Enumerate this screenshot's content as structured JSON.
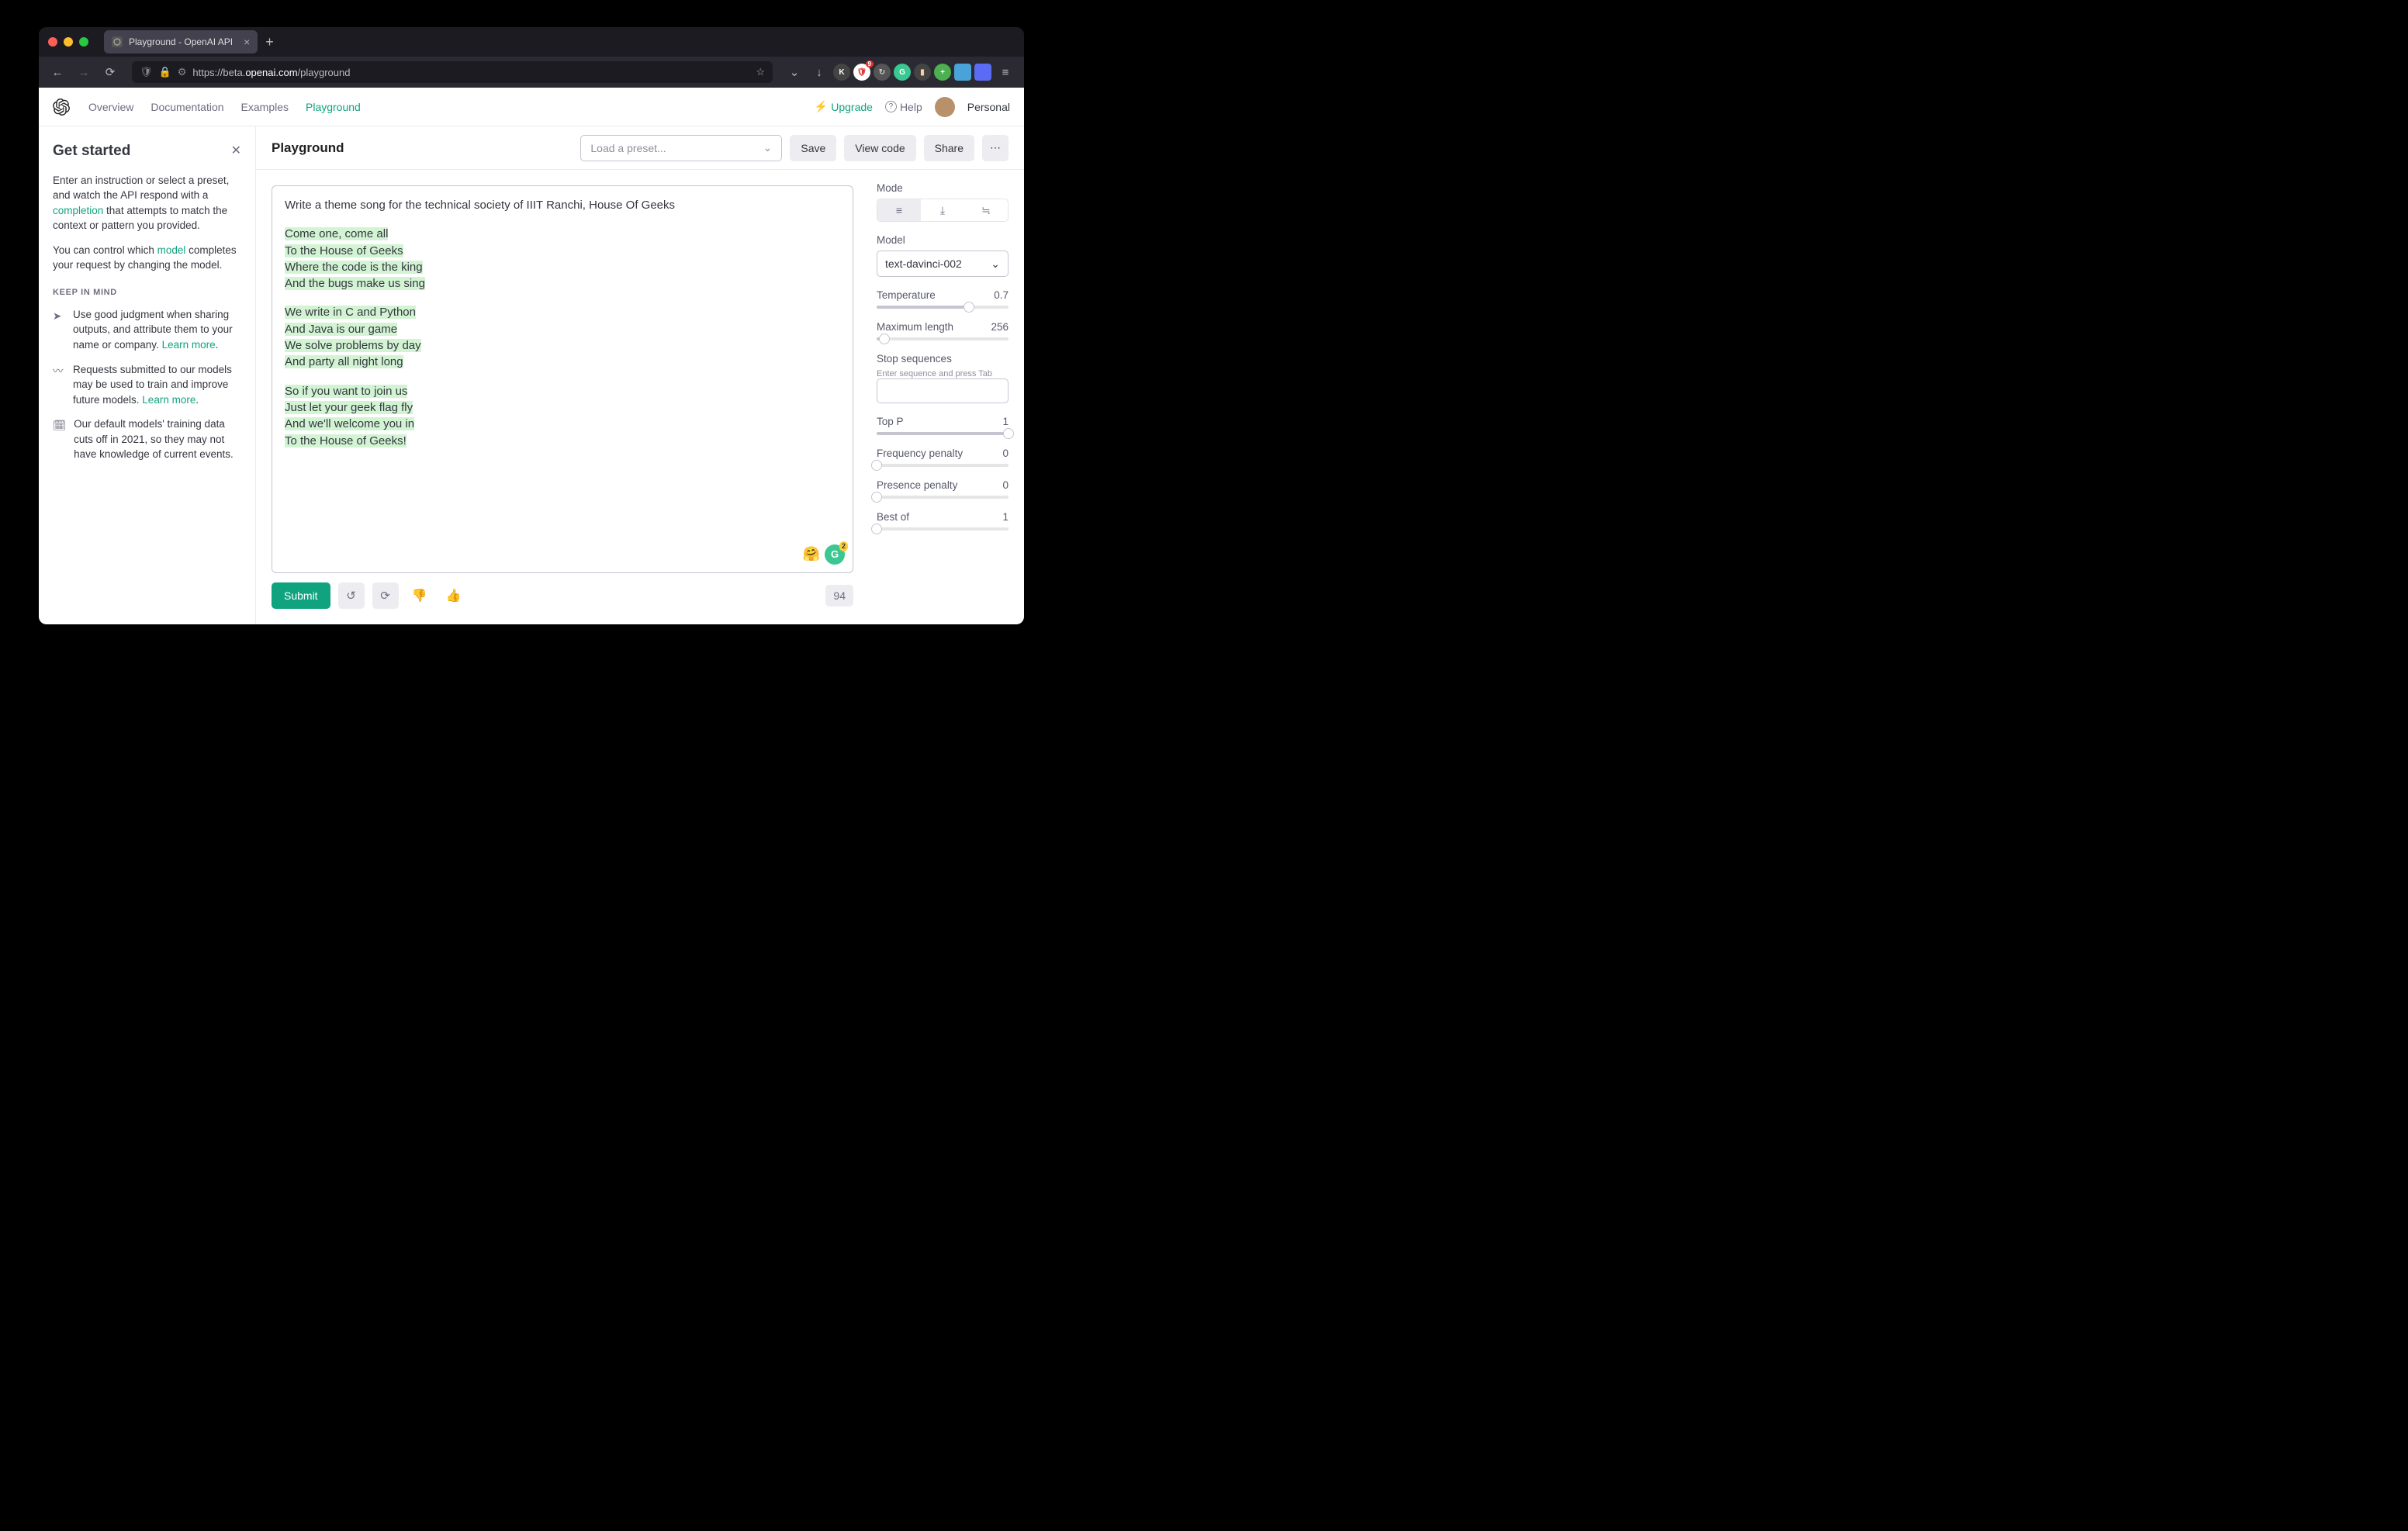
{
  "browser": {
    "tab_title": "Playground - OpenAI API",
    "url_prefix": "https://",
    "url_sub": "beta.",
    "url_domain": "openai.com",
    "url_path": "/playground",
    "ext_badge": "9"
  },
  "nav": {
    "overview": "Overview",
    "documentation": "Documentation",
    "examples": "Examples",
    "playground": "Playground",
    "upgrade": "Upgrade",
    "help": "Help",
    "personal": "Personal"
  },
  "sidebar": {
    "title": "Get started",
    "p1a": "Enter an instruction or select a preset, and watch the API respond with a ",
    "p1_link": "completion",
    "p1b": " that attempts to match the context or pattern you provided.",
    "p2a": "You can control which ",
    "p2_link": "model",
    "p2b": " completes your request by changing the model.",
    "kim_heading": "KEEP IN MIND",
    "kim1": "Use good judgment when sharing outputs, and attribute them to your name or company. ",
    "kim1_link": "Learn more",
    "kim2": "Requests submitted to our models may be used to train and improve future models. ",
    "kim2_link": "Learn more",
    "kim3": "Our default models' training data cuts off in 2021, so they may not have knowledge of current events."
  },
  "playground": {
    "title": "Playground",
    "preset_placeholder": "Load a preset...",
    "save": "Save",
    "view_code": "View code",
    "share": "Share",
    "prompt": "Write a theme song for the technical society of IIIT Ranchi, House Of Geeks",
    "completion": [
      [
        "Come one, come all",
        "To the House of Geeks",
        "Where the code is the king",
        "And the bugs make us sing"
      ],
      [
        "We write in C and Python",
        "And Java is our game",
        "We solve problems by day",
        "And party all night long"
      ],
      [
        "So if you want to join us",
        "Just let your geek flag fly",
        "And we'll welcome you in",
        "To the House of Geeks!"
      ]
    ],
    "submit": "Submit",
    "token_count": "94",
    "grammarly_count": "2"
  },
  "params": {
    "mode_label": "Mode",
    "model_label": "Model",
    "model_value": "text-davinci-002",
    "temperature_label": "Temperature",
    "temperature_value": "0.7",
    "maxlen_label": "Maximum length",
    "maxlen_value": "256",
    "stop_label": "Stop sequences",
    "stop_hint": "Enter sequence and press Tab",
    "topp_label": "Top P",
    "topp_value": "1",
    "freq_label": "Frequency penalty",
    "freq_value": "0",
    "pres_label": "Presence penalty",
    "pres_value": "0",
    "bestof_label": "Best of",
    "bestof_value": "1"
  }
}
